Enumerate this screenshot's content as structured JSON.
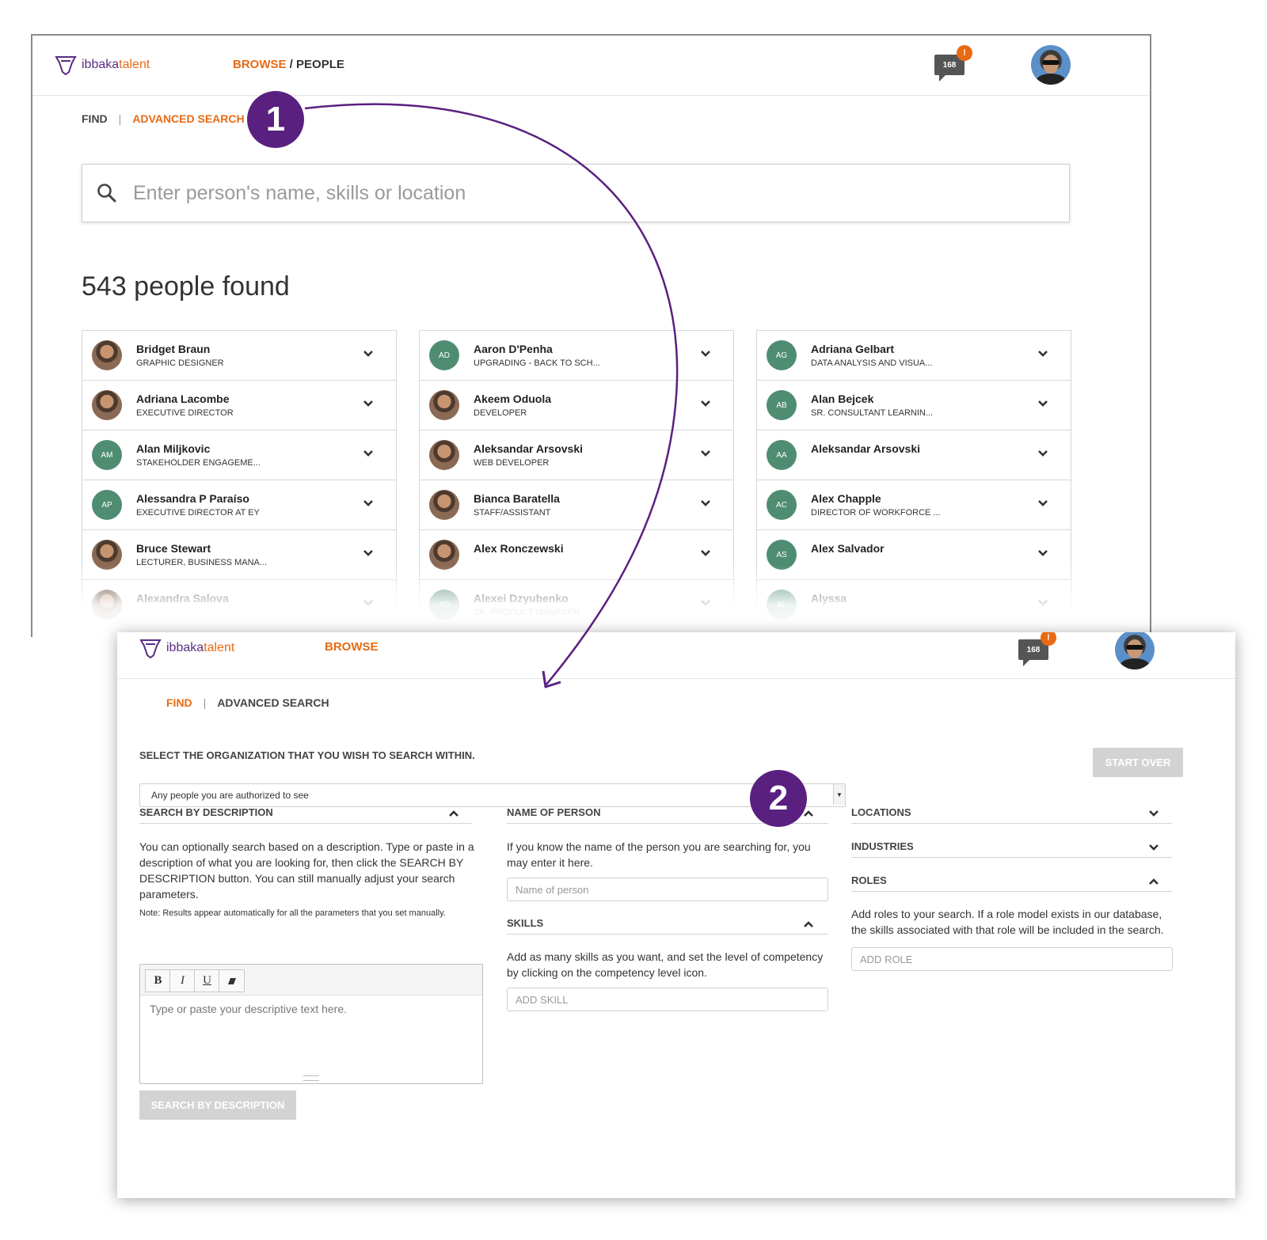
{
  "colors": {
    "brand_purple": "#5a2d82",
    "brand_orange": "#e86a13",
    "callout_purple": "#5a2080",
    "avatar_green": "#4f8d72"
  },
  "callouts": {
    "one": "1",
    "two": "2"
  },
  "screen1": {
    "logo": {
      "part1": "ibbaka",
      "part2": "talent"
    },
    "breadcrumb": {
      "browse": "BROWSE",
      "sep": " / ",
      "people": "PEOPLE"
    },
    "notifications": {
      "count": "168",
      "alert": "!"
    },
    "tabs": {
      "find": "FIND",
      "sep": "|",
      "advanced": "ADVANCED SEARCH"
    },
    "search": {
      "placeholder": "Enter person's name, skills or location"
    },
    "found_text": "543 people found",
    "columns": [
      [
        {
          "name": "Bridget Braun",
          "title": "GRAPHIC DESIGNER",
          "initials": "",
          "photo": true
        },
        {
          "name": "Adriana Lacombe",
          "title": "EXECUTIVE DIRECTOR",
          "initials": "",
          "photo": true
        },
        {
          "name": "Alan Miljkovic",
          "title": "STAKEHOLDER ENGAGEME...",
          "initials": "AM",
          "photo": false
        },
        {
          "name": "Alessandra P Paraíso",
          "title": "EXECUTIVE DIRECTOR AT EY",
          "initials": "AP",
          "photo": false
        },
        {
          "name": "Bruce Stewart",
          "title": "LECTURER, BUSINESS MANA...",
          "initials": "",
          "photo": true
        },
        {
          "name": "Alexandra Salova",
          "title": "",
          "initials": "",
          "photo": true
        }
      ],
      [
        {
          "name": "Aaron D'Penha",
          "title": "UPGRADING - BACK TO SCH...",
          "initials": "AD",
          "photo": false
        },
        {
          "name": "Akeem Oduola",
          "title": "DEVELOPER",
          "initials": "",
          "photo": true
        },
        {
          "name": "Aleksandar Arsovski",
          "title": "WEB DEVELOPER",
          "initials": "",
          "photo": true
        },
        {
          "name": "Bianca Baratella",
          "title": "STAFF/ASSISTANT",
          "initials": "",
          "photo": true
        },
        {
          "name": "Alex Ronczewski",
          "title": "",
          "initials": "",
          "photo": true
        },
        {
          "name": "Alexei Dzyubenko",
          "title": "SR. PRODUCT MANAGER",
          "initials": "AD",
          "photo": false
        }
      ],
      [
        {
          "name": "Adriana Gelbart",
          "title": "DATA ANALYSIS AND VISUA...",
          "initials": "AG",
          "photo": false
        },
        {
          "name": "Alan Bejcek",
          "title": "SR. CONSULTANT LEARNIN...",
          "initials": "AB",
          "photo": false
        },
        {
          "name": "Aleksandar Arsovski",
          "title": "",
          "initials": "AA",
          "photo": false
        },
        {
          "name": "Alex Chapple",
          "title": "DIRECTOR OF WORKFORCE ...",
          "initials": "AC",
          "photo": false
        },
        {
          "name": "Alex Salvador",
          "title": "",
          "initials": "AS",
          "photo": false
        },
        {
          "name": "Alyssa",
          "title": "",
          "initials": "AL",
          "photo": false
        }
      ]
    ]
  },
  "screen2": {
    "logo": {
      "part1": "ibbaka",
      "part2": "talent"
    },
    "nav": {
      "browse": "BROWSE"
    },
    "notifications": {
      "count": "168",
      "alert": "!"
    },
    "tabs": {
      "find": "FIND",
      "sep": "|",
      "advanced": "ADVANCED SEARCH"
    },
    "org": {
      "label": "SELECT THE ORGANIZATION THAT YOU WISH TO SEARCH WITHIN.",
      "value": "Any people you are authorized to see"
    },
    "start_over": "START OVER",
    "description": {
      "title": "SEARCH BY DESCRIPTION",
      "text": "You can optionally search based on a description. Type or paste in a description of what you are looking for, then click the SEARCH BY DESCRIPTION button. You can still manually adjust your search parameters.",
      "note": "Note: Results appear automatically for all the parameters that you set manually.",
      "editor_placeholder": "Type or paste your descriptive text here.",
      "toolbar": {
        "bold": "B",
        "italic": "I",
        "underline": "U"
      },
      "button": "SEARCH BY DESCRIPTION"
    },
    "name_of_person": {
      "title": "NAME OF PERSON",
      "text": "If you know the name of the person you are searching for, you may enter it here.",
      "placeholder": "Name of person"
    },
    "skills": {
      "title": "SKILLS",
      "text": "Add as many skills as you want, and set the level of competency by clicking on the competency level icon.",
      "placeholder": "ADD SKILL"
    },
    "locations": {
      "title": "LOCATIONS"
    },
    "industries": {
      "title": "INDUSTRIES"
    },
    "roles": {
      "title": "ROLES",
      "text": "Add roles to your search. If a role model exists in our database, the skills associated with that role will be included in the search.",
      "placeholder": "ADD ROLE"
    }
  }
}
